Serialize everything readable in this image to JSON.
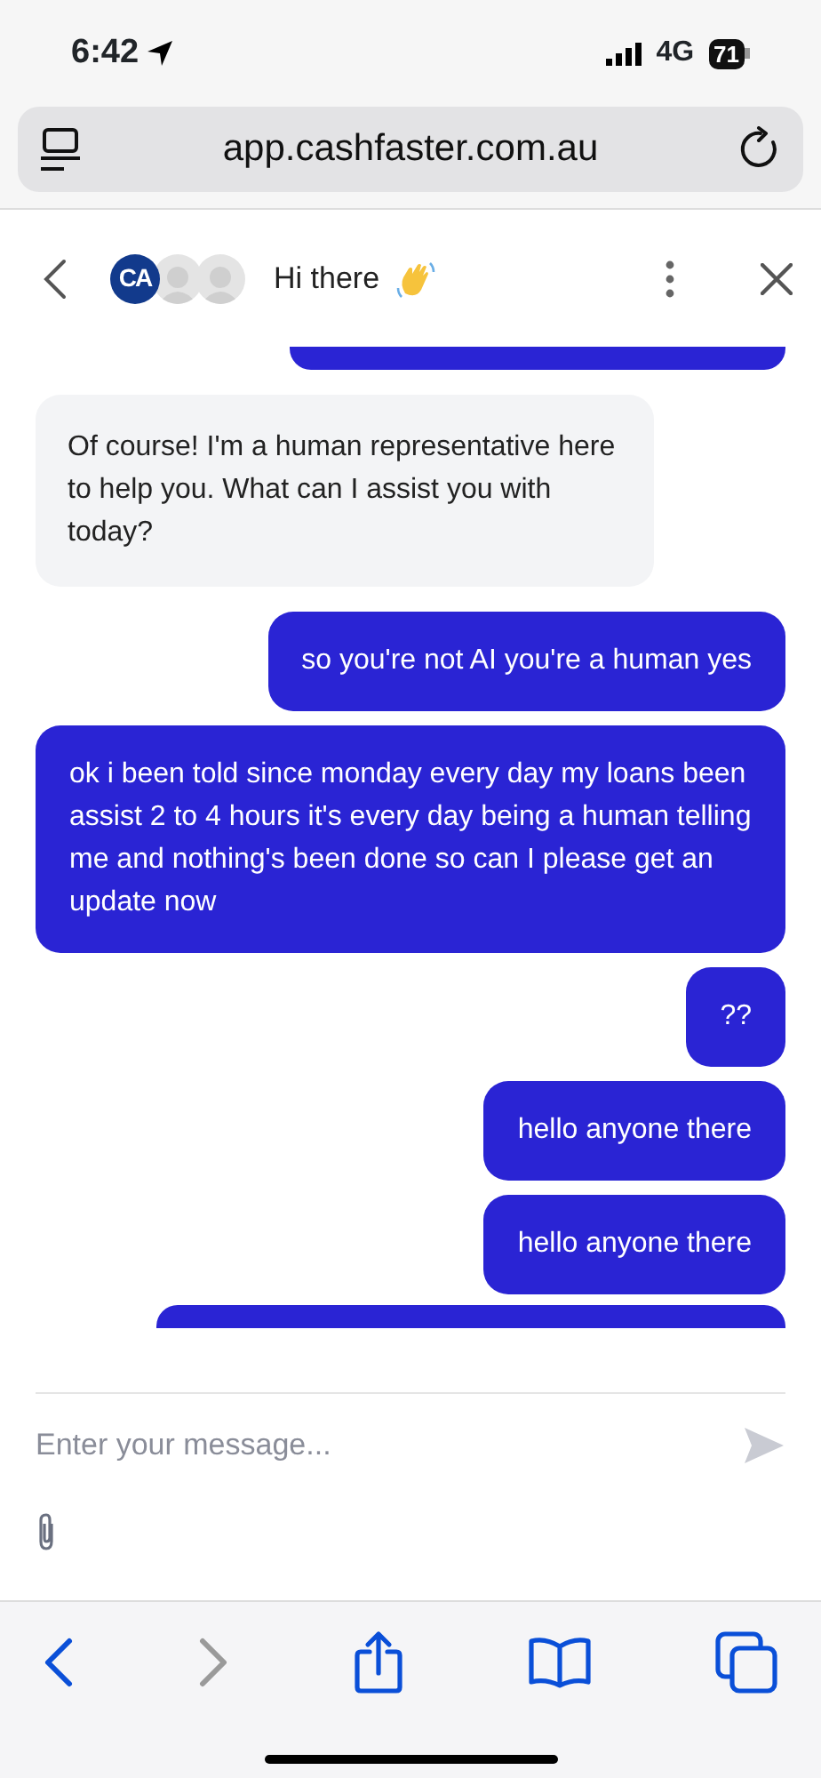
{
  "status_bar": {
    "time": "6:42",
    "network": "4G",
    "battery": "71"
  },
  "address_bar": {
    "url": "app.cashfaster.com.au"
  },
  "chat_header": {
    "logo": "CA",
    "title": "Hi there"
  },
  "messages": [
    {
      "kind": "clipped-sent-top"
    },
    {
      "kind": "received",
      "text": "Of course! I'm a human representative here to help you. What can I assist you with today?"
    },
    {
      "kind": "sent",
      "text": "so you're not AI you're a human yes"
    },
    {
      "kind": "sent",
      "text": "ok i been told since monday every day my loans been assist 2 to 4 hours it's every day being a human telling me and nothing's been done so can I please get an update now"
    },
    {
      "kind": "sent",
      "text": "??"
    },
    {
      "kind": "sent",
      "text": "hello anyone there"
    },
    {
      "kind": "sent",
      "text": "hello anyone there"
    },
    {
      "kind": "clipped-sent-bottom"
    }
  ],
  "composer": {
    "placeholder": "Enter your message..."
  },
  "toolbar": [
    {
      "kind": "back",
      "disabled": false
    },
    {
      "kind": "forward",
      "disabled": true
    },
    {
      "kind": "share",
      "disabled": false
    },
    {
      "kind": "bookmarks",
      "disabled": false
    },
    {
      "kind": "tabs",
      "disabled": false
    }
  ]
}
